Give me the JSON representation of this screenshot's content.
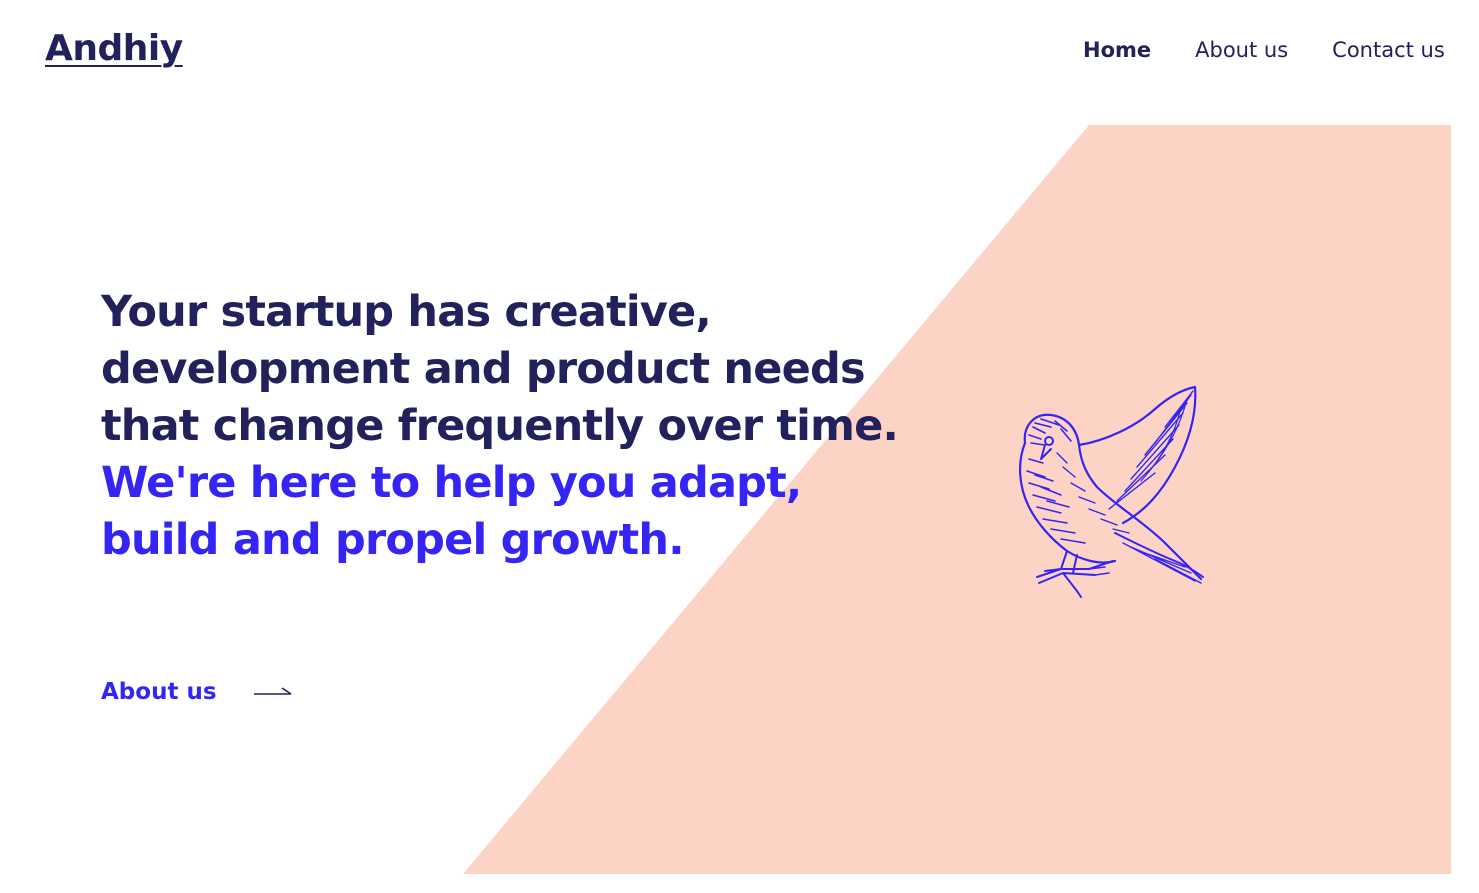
{
  "header": {
    "logo": "Andhiy",
    "nav": [
      {
        "label": "Home",
        "active": true
      },
      {
        "label": "About us",
        "active": false
      },
      {
        "label": "Contact us",
        "active": false
      }
    ]
  },
  "hero": {
    "lines_primary": [
      "Your startup has creative,",
      "development and product needs",
      "that change frequently over time."
    ],
    "lines_accent": [
      "We're here to help you adapt,",
      "build and propel growth."
    ]
  },
  "cta": {
    "label": "About us",
    "icon": "arrow-right-icon"
  },
  "illustration": {
    "icon": "bird-illustration"
  },
  "colors": {
    "navy": "#22215b",
    "accent": "#3425f5",
    "peach": "#fdd3c6",
    "background": "#ffffff"
  }
}
